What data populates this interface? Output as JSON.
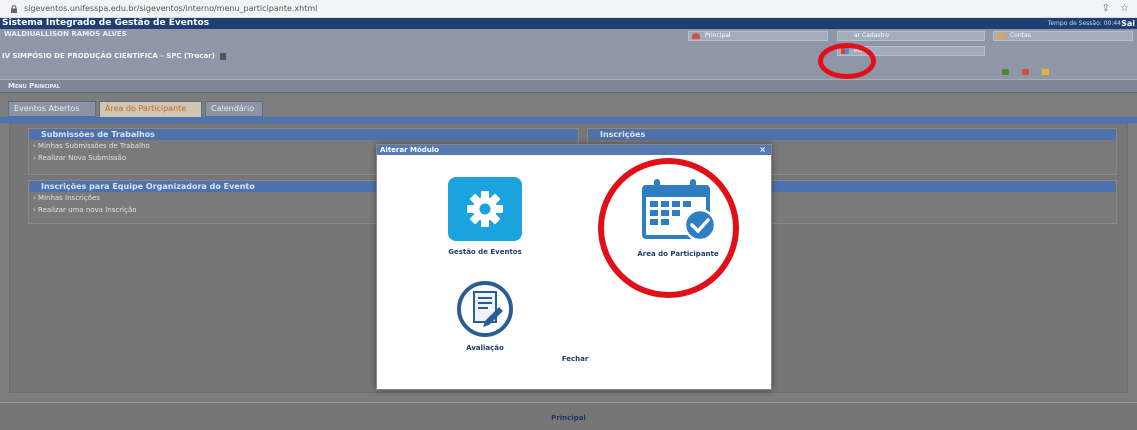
{
  "browser": {
    "url": "sigeventos.unifesspa.edu.br/sigeventos/interno/menu_participante.xhtml"
  },
  "system": {
    "title": "Sistema Integrado de Gestão de Eventos",
    "session_label": "Tempo de Sessão: 00:44",
    "exit_label": "Sai"
  },
  "header": {
    "user_name": "WALDIUALLISON RAMOS ALVES",
    "event_name": "IV SIMPÓSIO DE PRODUÇÃO CIENTÍFICA – SPC (Trocar)",
    "buttons": {
      "principal": "Principal",
      "cadastro": "ar Cadastro",
      "contas": "Contas",
      "modulos": "Mod"
    }
  },
  "menu_title": "Menu Principal",
  "tabs": [
    "Eventos Abertos",
    "Área do Participante",
    "Calendário"
  ],
  "cards": {
    "submissoes": {
      "title": "Submissões de Trabalhos",
      "links": [
        "› Minhas Submissões de Trabalho",
        "› Realizar Nova Submissão"
      ]
    },
    "inscricoes": {
      "title": "Inscrições"
    },
    "equipe": {
      "title": "Inscrições para Equipe Organizadora do Evento",
      "links": [
        "› Minhas Inscrições",
        "› Realizar uma nova Inscrição"
      ]
    }
  },
  "modal": {
    "title": "Alterar Módulo",
    "close": "×",
    "modules": [
      "Gestão de Eventos",
      "Área do Participante",
      "Avaliação"
    ],
    "fechar": "Fechar"
  },
  "footer": {
    "label": "Principal"
  },
  "colors": {
    "highlight": "#e10f17",
    "accent": "#4e71ab",
    "icon_blue": "#1ba3de"
  }
}
